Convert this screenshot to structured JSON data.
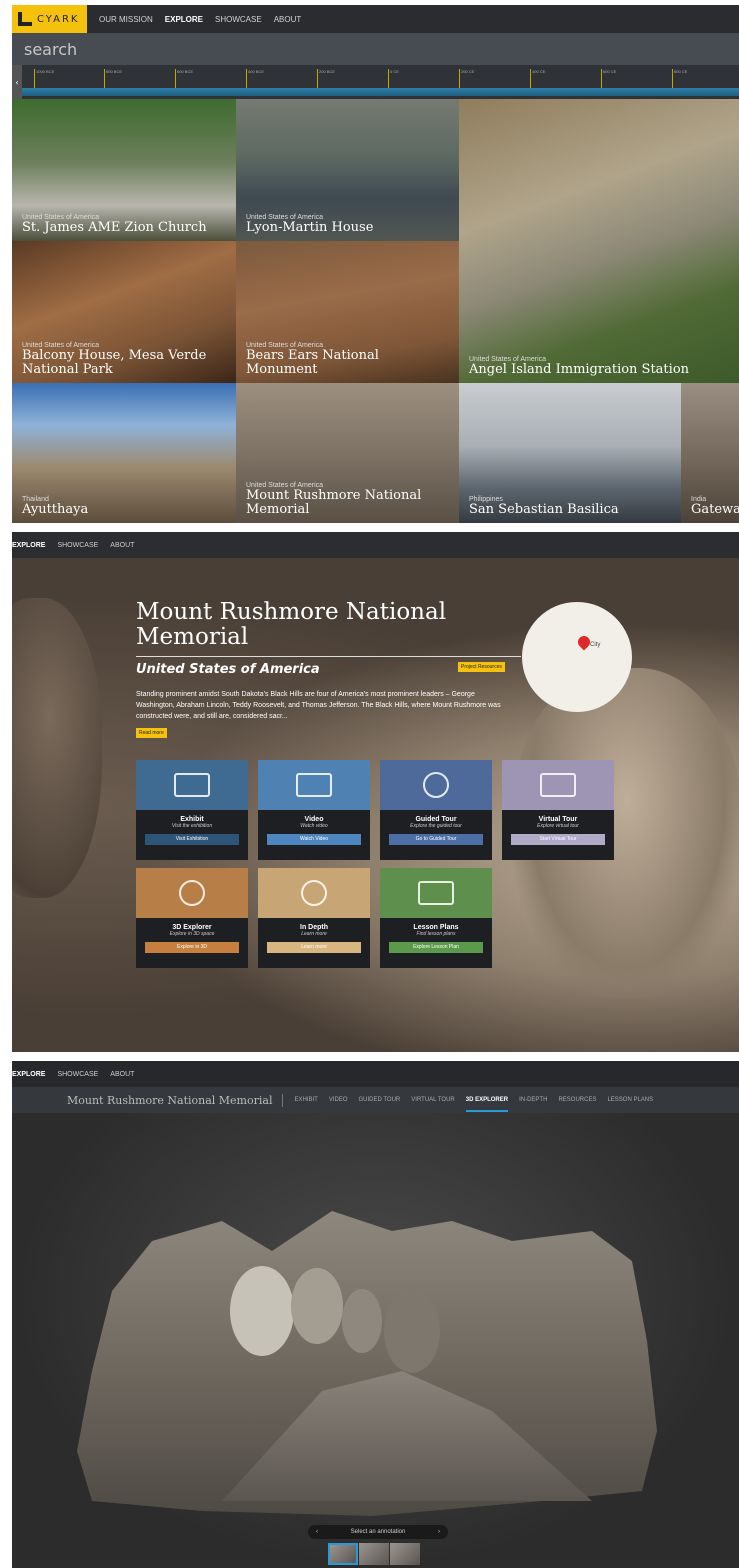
{
  "panel1": {
    "logo": "CYARK",
    "nav": [
      "OUR MISSION",
      "EXPLORE",
      "SHOWCASE",
      "ABOUT"
    ],
    "search_placeholder": "search",
    "timeline_nav": "‹",
    "timeline": [
      "1000 BCE",
      "800 BCE",
      "600 BCE",
      "400 BCE",
      "200 BCE",
      "0 CE",
      "200 CE",
      "400 CE",
      "600 CE",
      "800 CE"
    ],
    "tiles": [
      {
        "country": "United States of America",
        "name": "St. James AME Zion Church"
      },
      {
        "country": "United States of America",
        "name": "Lyon-Martin House"
      },
      {
        "country": "United States of America",
        "name": "Angel Island Immigration Station"
      },
      {
        "country": "United States of America",
        "name": "Balcony House, Mesa Verde National Park"
      },
      {
        "country": "United States of America",
        "name": "Bears Ears National Monument"
      },
      {
        "country": "Thailand",
        "name": "Ayutthaya"
      },
      {
        "country": "United States of America",
        "name": "Mount Rushmore National Memorial"
      },
      {
        "country": "Philippines",
        "name": "San Sebastian Basilica"
      },
      {
        "country": "India",
        "name": "Gatewa"
      }
    ]
  },
  "panel2": {
    "nav": [
      "EXPLORE",
      "SHOWCASE",
      "ABOUT"
    ],
    "title": "Mount Rushmore National Memorial",
    "subtitle": "United States of America",
    "project_resources": "Project Resources",
    "description": "Standing prominent amidst South Dakota's Black Hills are four of America's most prominent leaders – George Washington, Abraham Lincoln, Teddy Roosevelt, and Thomas Jefferson. The Black Hills, where Mount Rushmore was constructed were, and still are, considered sacr...",
    "read_more": "Read more",
    "map_label": "City",
    "cards": [
      {
        "title": "Exhibit",
        "sub": "Visit the exhibition",
        "button": "Visit Exhibition",
        "color": "#3f6b93",
        "btn_color": "#2d5577"
      },
      {
        "title": "Video",
        "sub": "Watch video",
        "button": "Watch Video",
        "color": "#4f82b2",
        "btn_color": "#4f86c0"
      },
      {
        "title": "Guided Tour",
        "sub": "Explore the guided tour",
        "button": "Go to Guided Tour",
        "color": "#4e6a9a",
        "btn_color": "#4d6fa5"
      },
      {
        "title": "Virtual Tour",
        "sub": "Explore virtual tour",
        "button": "Start Virtual Tour",
        "color": "#9d95b3",
        "btn_color": "#b0a9c8"
      },
      {
        "title": "3D Explorer",
        "sub": "Explore in 3D space",
        "button": "Explore in 3D",
        "color": "#b77e47",
        "btn_color": "#c77f3d"
      },
      {
        "title": "In Depth",
        "sub": "Learn more",
        "button": "Learn more",
        "color": "#c8a574",
        "btn_color": "#d9b67f"
      },
      {
        "title": "Lesson Plans",
        "sub": "Find lesson plans",
        "button": "Explore Lesson Plan",
        "color": "#5e8f4d",
        "btn_color": "#5c9a4b"
      }
    ]
  },
  "panel3": {
    "nav": [
      "EXPLORE",
      "SHOWCASE",
      "ABOUT"
    ],
    "title": "Mount Rushmore National Memorial",
    "tabs": [
      "EXHIBIT",
      "VIDEO",
      "GUIDED TOUR",
      "VIRTUAL TOUR",
      "3D EXPLORER",
      "IN-DEPTH",
      "RESOURCES",
      "LESSON PLANS"
    ],
    "active_tab": "3D EXPLORER",
    "annotation_label": "Select an annotation",
    "annotation_prev": "‹",
    "annotation_next": "›"
  }
}
